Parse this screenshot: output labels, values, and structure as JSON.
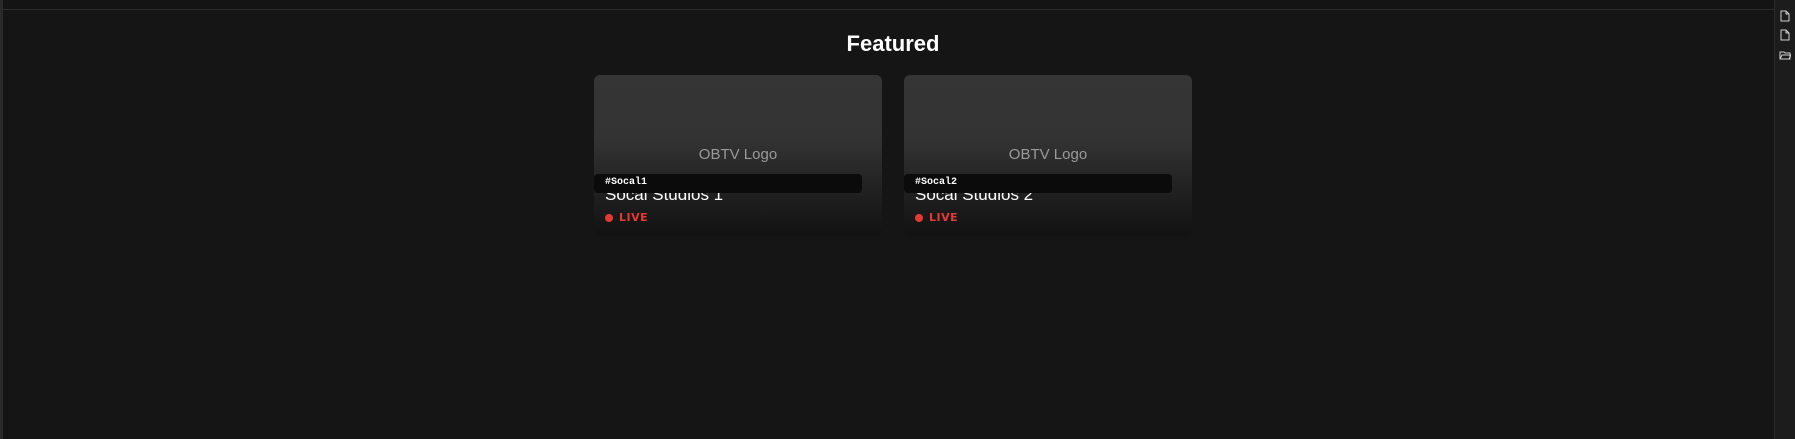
{
  "featured": {
    "heading": "Featured",
    "cards": [
      {
        "id_label": "#Socal1",
        "logo_text": "OBTV Logo",
        "title": "Socal Studios 1",
        "status": "LIVE"
      },
      {
        "id_label": "#Socal2",
        "logo_text": "OBTV Logo",
        "title": "Socal Studios 2",
        "status": "LIVE"
      }
    ]
  },
  "colors": {
    "background": "#151515",
    "card_top": "#353535",
    "live_red": "#e53935"
  },
  "right_rail": {
    "icons": [
      "file-icon",
      "file-icon",
      "folder-open-icon"
    ]
  }
}
